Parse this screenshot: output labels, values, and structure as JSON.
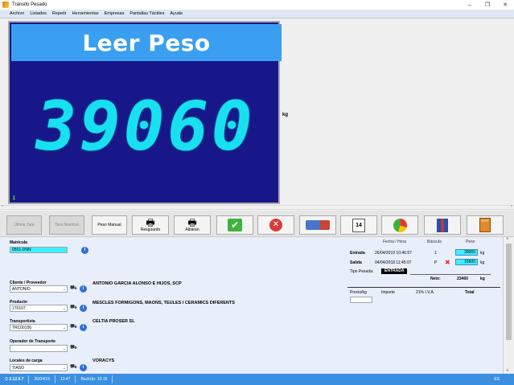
{
  "window": {
    "title": "Tránsito Pesado",
    "minimize": "–",
    "maximize": "❐",
    "close": "✕"
  },
  "menu": [
    "Archivo",
    "Listados",
    "Repetir",
    "Herramientas",
    "Empresas",
    "Pantallas Táctiles",
    "Ayuda"
  ],
  "display": {
    "title": "Leer Peso",
    "weight": "39060",
    "unit": "kg",
    "status_icon": "down-arrow-icon"
  },
  "toolbar": {
    "ultima_tara": "Última Tara",
    "tara_nominal": "Tara Nominal",
    "peso_manual": "Peso Manual",
    "resguardo": "Resguardo",
    "albaran": "Albarán"
  },
  "form": {
    "matricula_label": "Matrícula",
    "matricula_value": "0551-DNN",
    "cliente_label": "Cliente / Proveedor",
    "cliente_value": "ANTONIO",
    "cliente_name": "ANTONIO GARCIA ALONSO E HIJOS, SCP",
    "producto_label": "Producto",
    "producto_value": "170107",
    "producto_name": "MESCLES FORMIGONS, MAONS, TEULES I CERAMICS DIFERENTS",
    "transportista_label": "Transportista",
    "transportista_value": "TRC00156",
    "transportista_name": "CELTIA PROSER SL",
    "operador_label": "Operador de Transporte",
    "operador_value": "",
    "locales_label": "Locales de carga",
    "locales_value": "TIASO",
    "locales_name": "VORACYS"
  },
  "weights": {
    "col_fecha": "Fecha / Hora",
    "col_bascula": "Báscula",
    "col_peso": "Peso",
    "entrada_label": "Entrada",
    "entrada_fecha": "26/04/2019 10:46:57",
    "entrada_bascula": "1",
    "entrada_peso": "39060",
    "salida_label": "Salida",
    "salida_fecha": "04/04/2018 11:45:07",
    "salida_bascula": "P",
    "salida_peso": "15600",
    "unit": "kg",
    "tipo_label": "Tipo Pesada:",
    "tipo_value": "ENTRADA",
    "neto_label": "Neto:",
    "neto_value": "23460",
    "neto_unit": "kg",
    "precio_label": "Precio/kg",
    "importe_label": "Importe",
    "iva_label": "21% I.V.A.",
    "total_label": "Total"
  },
  "status": {
    "version": "2.12.0.7",
    "date": "26/04/19",
    "time": "10:47",
    "backup": "BackUp: 10:15",
    "right": "ES"
  }
}
